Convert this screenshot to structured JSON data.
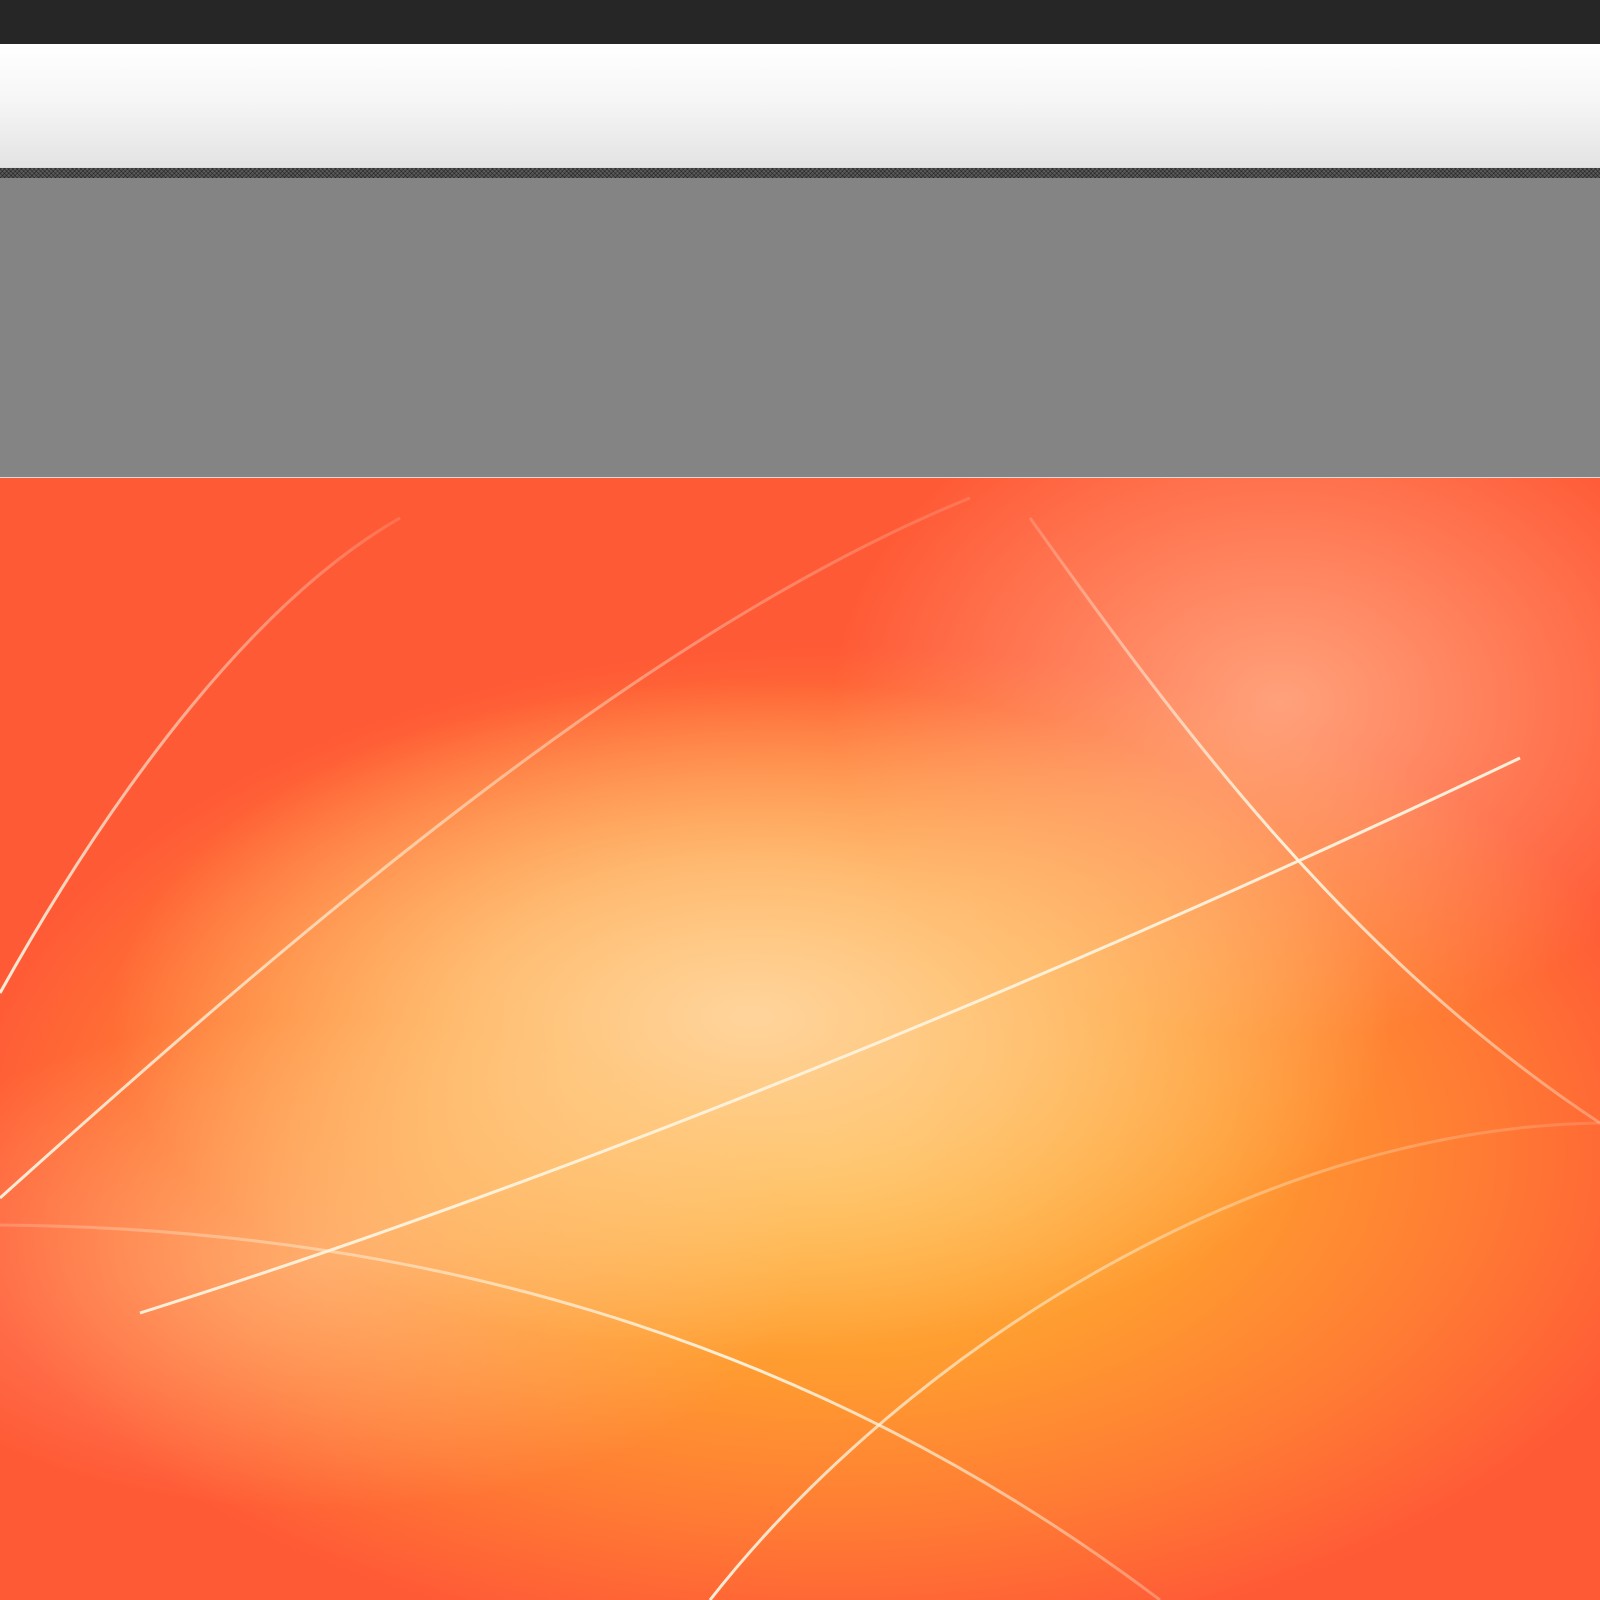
{
  "window": {
    "title": ""
  },
  "colors": {
    "top_bar": "#262626",
    "header_gradient_top": "#ffffff",
    "header_gradient_bottom": "#e3e3e3",
    "divider": "#5b5b5b",
    "content_panel": "#848484",
    "wallpaper_center": "#ffbb3a",
    "wallpaper_edge": "#ff5a36",
    "wallpaper_highlight": "#ffd49c",
    "wallpaper_lines": "#fff4e0"
  },
  "wallpaper": {
    "name": "orange-abstract-curves-wallpaper"
  }
}
